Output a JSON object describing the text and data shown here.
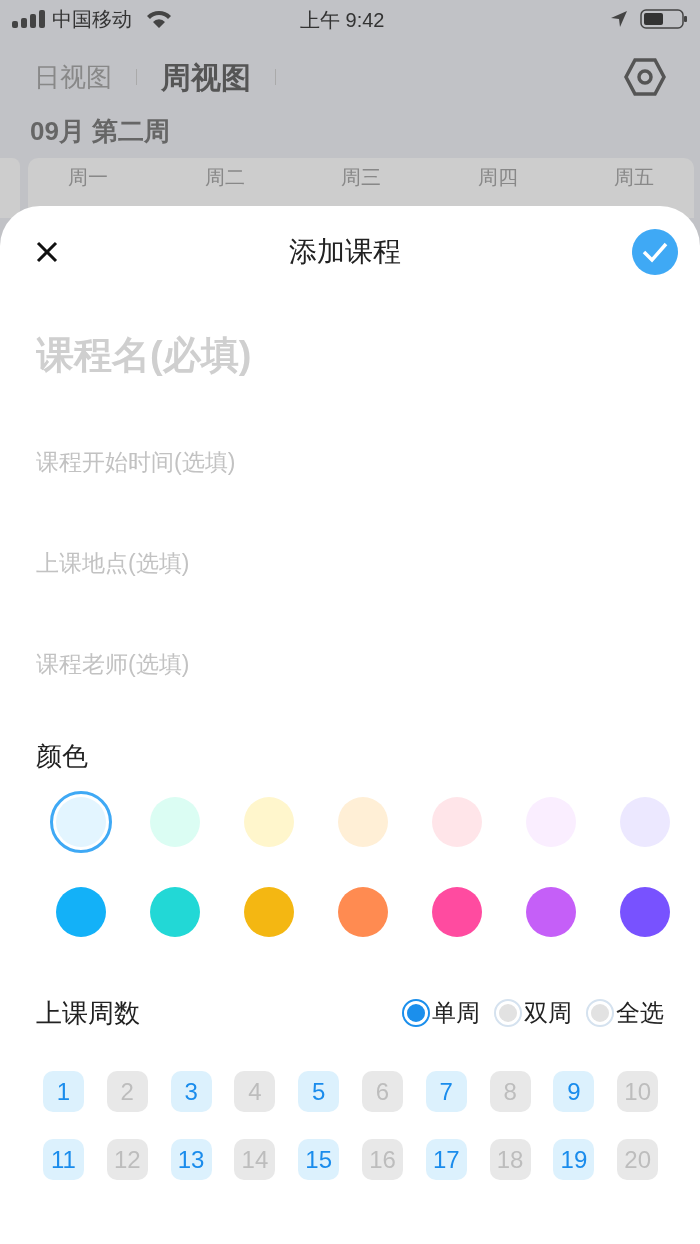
{
  "status_bar": {
    "carrier": "中国移动",
    "time": "上午 9:42"
  },
  "view_tabs": [
    {
      "label": "日视图",
      "selected": false
    },
    {
      "label": "周视图",
      "selected": true
    }
  ],
  "week_title": "09月 第二周",
  "weekdays": [
    "周一",
    "周二",
    "周三",
    "周四",
    "周五"
  ],
  "sheet": {
    "title": "添加课程",
    "fields": [
      {
        "kind": "large",
        "placeholder": "课程名(必填)"
      },
      {
        "kind": "small",
        "placeholder": "课程开始时间(选填)"
      },
      {
        "kind": "small",
        "placeholder": "上课地点(选填)"
      },
      {
        "kind": "small",
        "placeholder": "课程老师(选填)"
      }
    ],
    "color_label": "颜色",
    "colors": [
      {
        "color": "#e3f5ff",
        "selected": true
      },
      {
        "color": "#dbfdf3",
        "selected": false
      },
      {
        "color": "#fff6cc",
        "selected": false
      },
      {
        "color": "#ffefd6",
        "selected": false
      },
      {
        "color": "#ffe5e9",
        "selected": false
      },
      {
        "color": "#faeeff",
        "selected": false
      },
      {
        "color": "#ece8ff",
        "selected": false
      },
      {
        "color": "#13b1f8",
        "selected": false
      },
      {
        "color": "#22d8d6",
        "selected": false
      },
      {
        "color": "#f4b712",
        "selected": false
      },
      {
        "color": "#ff8b51",
        "selected": false
      },
      {
        "color": "#ff4ba0",
        "selected": false
      },
      {
        "color": "#c55ff8",
        "selected": false
      },
      {
        "color": "#7852ff",
        "selected": false
      }
    ],
    "weeks_label": "上课周数",
    "week_modes": [
      {
        "label": "单周",
        "selected": true
      },
      {
        "label": "双周",
        "selected": false
      },
      {
        "label": "全选",
        "selected": false
      }
    ],
    "weeks": [
      {
        "label": "1",
        "selected": true
      },
      {
        "label": "2",
        "selected": false
      },
      {
        "label": "3",
        "selected": true
      },
      {
        "label": "4",
        "selected": false
      },
      {
        "label": "5",
        "selected": true
      },
      {
        "label": "6",
        "selected": false
      },
      {
        "label": "7",
        "selected": true
      },
      {
        "label": "8",
        "selected": false
      },
      {
        "label": "9",
        "selected": true
      },
      {
        "label": "10",
        "selected": false
      },
      {
        "label": "11",
        "selected": true
      },
      {
        "label": "12",
        "selected": false
      },
      {
        "label": "13",
        "selected": true
      },
      {
        "label": "14",
        "selected": false
      },
      {
        "label": "15",
        "selected": true
      },
      {
        "label": "16",
        "selected": false
      },
      {
        "label": "17",
        "selected": true
      },
      {
        "label": "18",
        "selected": false
      },
      {
        "label": "19",
        "selected": true
      },
      {
        "label": "20",
        "selected": false
      }
    ]
  }
}
